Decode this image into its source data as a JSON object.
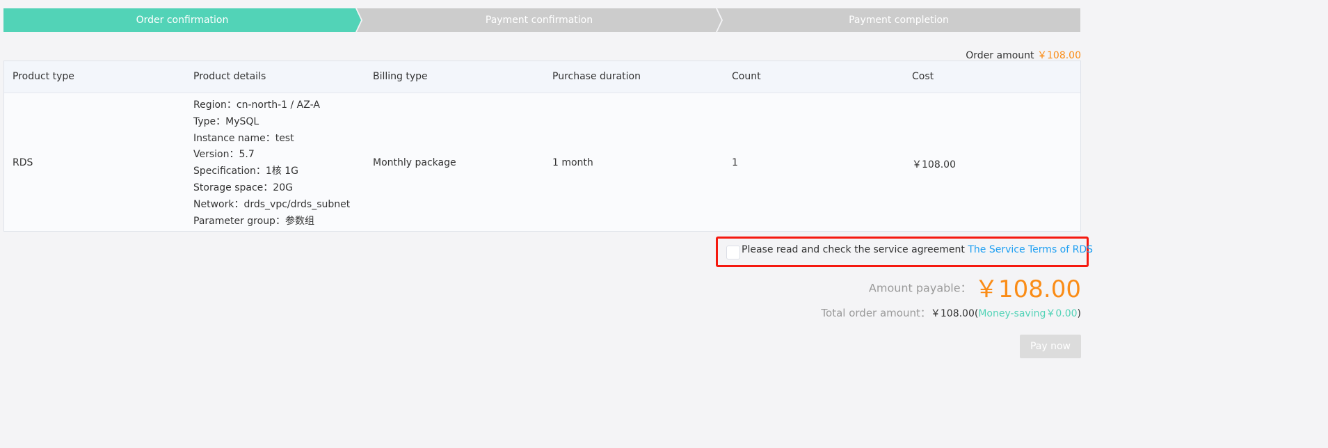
{
  "steps": [
    {
      "label": "Order confirmation",
      "active": true
    },
    {
      "label": "Payment confirmation",
      "active": false
    },
    {
      "label": "Payment completion",
      "active": false
    }
  ],
  "order_amount": {
    "label": "Order amount",
    "value": "￥108.00"
  },
  "table": {
    "headers": [
      "Product type",
      "Product details",
      "Billing type",
      "Purchase duration",
      "Count",
      "Cost"
    ],
    "row": {
      "product_type": "RDS",
      "details": [
        "Region：cn-north-1 / AZ-A",
        "Type：MySQL",
        "Instance name：test",
        "Version：5.7",
        "Specification：1核 1G",
        "Storage space：20G",
        "Network：drds_vpc/drds_subnet",
        "Parameter group：参数组"
      ],
      "billing_type": "Monthly package",
      "duration": "1 month",
      "count": "1",
      "cost": "￥108.00"
    }
  },
  "agreement": {
    "text": "Please read and check the service agreement",
    "link": "The Service Terms of RDS",
    "checked": false
  },
  "payable": {
    "label": "Amount payable：",
    "value": "￥108.00"
  },
  "total": {
    "label": "Total order amount：",
    "value": "￥108.00(",
    "saving": "Money-saving￥0.00",
    ")": ")",
    "close": ")"
  },
  "pay_button": "Pay now",
  "colors": {
    "accent": "#52d3b7",
    "orange": "#fa8c16",
    "link": "#1e9ff2",
    "highlight": "#f5190f"
  }
}
